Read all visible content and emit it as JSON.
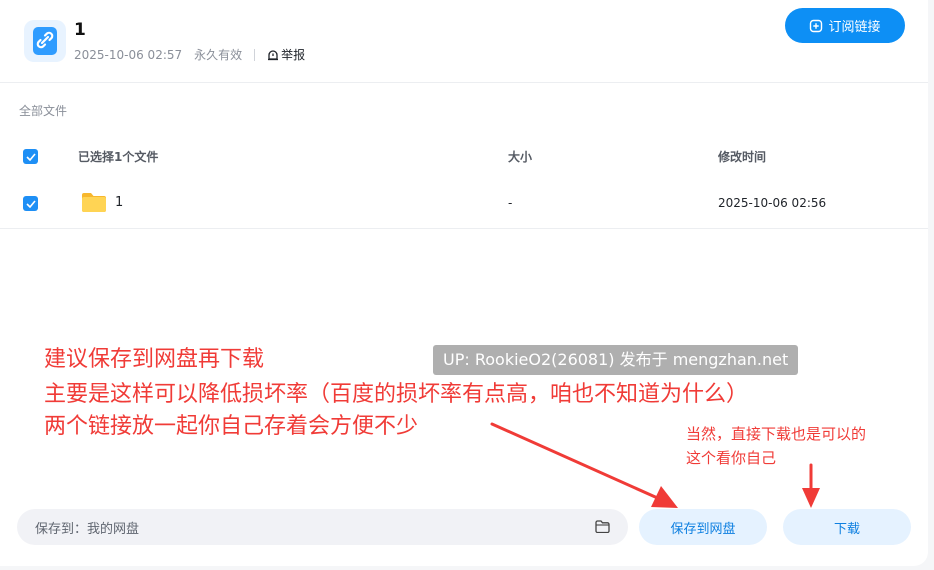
{
  "header": {
    "title": "1",
    "date": "2025-10-06 02:57",
    "validity": "永久有效",
    "report_label": "举报",
    "subscribe_label": "订阅链接"
  },
  "breadcrumb": "全部文件",
  "table": {
    "columns": [
      "已选择1个文件",
      "大小",
      "修改时间"
    ],
    "rows": [
      {
        "name": "1",
        "size": "-",
        "modified": "2025-10-06 02:56",
        "checked": true
      }
    ]
  },
  "annotations": {
    "main_lines": [
      "建议保存到网盘再下载",
      "主要是这样可以降低损坏率（百度的损坏率有点高，咱也不知道为什么）",
      "两个链接放一起你自己存着会方便不少"
    ],
    "watermark": "UP: RookieO2(26081) 发布于 mengzhan.net",
    "side_lines": [
      "当然，直接下载也是可以的",
      "这个看你自己"
    ]
  },
  "footer": {
    "save_to_label": "保存到：我的网盘",
    "save_button": "保存到网盘",
    "download_button": "下载"
  },
  "colors": {
    "accent": "#0d8ff5",
    "annotation_red": "#f03b37",
    "light_button_bg": "#e5f2ff"
  },
  "icons": [
    "link-icon",
    "report-icon",
    "add-circle-icon",
    "check-icon",
    "folder-icon",
    "folder-outline-icon"
  ]
}
